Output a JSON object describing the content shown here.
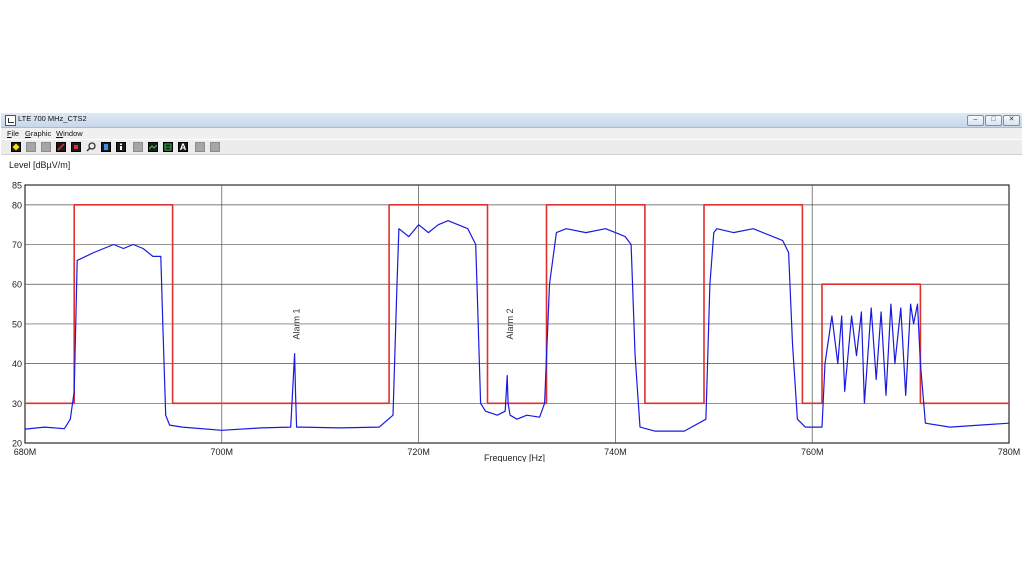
{
  "window": {
    "title": "LTE 700 MHz_CTS2",
    "menu": [
      {
        "label": "File",
        "accel": "F",
        "rest": "ile"
      },
      {
        "label": "Graphic",
        "accel": "G",
        "rest": "raphic"
      },
      {
        "label": "Window",
        "accel": "W",
        "rest": "indow"
      }
    ],
    "controls": {
      "minimize": "–",
      "maximize": "□",
      "close": "✕"
    },
    "toolbar_icons": [
      "diamond-icon",
      "grey-icon",
      "grey-icon",
      "marker-icon",
      "marker-icon",
      "magnifier-icon",
      "trace-icon",
      "info-icon",
      "grey-icon",
      "dark-icon",
      "dark-icon",
      "text-icon",
      "grey-icon",
      "grey-icon"
    ],
    "toolbar_text_icon_label": "A"
  },
  "colors": {
    "trace": "#1a1adf",
    "limit": "#e03030",
    "grid": "#505050",
    "diamond": "#f5e400"
  },
  "chart_data": {
    "type": "line",
    "xlabel": "Frequency [Hz]",
    "ylabel": "Level [dBµV/m]",
    "xlim": [
      680,
      780
    ],
    "ylim": [
      20,
      85
    ],
    "x_ticks": [
      680,
      700,
      720,
      740,
      760,
      780
    ],
    "x_tick_labels": [
      "680M",
      "700M",
      "720M",
      "740M",
      "760M",
      "780M"
    ],
    "y_ticks": [
      20,
      30,
      40,
      50,
      60,
      70,
      80,
      85
    ],
    "y_tick_labels": [
      "20",
      "30",
      "40",
      "50",
      "60",
      "70",
      "80",
      "85"
    ],
    "grid": true,
    "series": [
      {
        "role": "limit",
        "x": [
          680,
          685,
          685,
          695,
          695,
          717,
          717,
          727,
          727,
          733,
          733,
          743,
          743,
          749,
          749,
          759,
          759,
          761,
          761,
          771,
          771,
          780
        ],
        "y": [
          30,
          30,
          80,
          80,
          30,
          30,
          80,
          80,
          30,
          30,
          80,
          80,
          30,
          30,
          80,
          80,
          30,
          30,
          60,
          60,
          30,
          30
        ]
      },
      {
        "role": "measurement",
        "x": [
          680,
          682,
          684,
          684.6,
          685,
          685.3,
          687,
          689,
          690,
          691,
          692,
          693,
          693.8,
          694,
          694.3,
          694.7,
          696,
          700,
          704,
          707,
          707.4,
          707.5,
          707.6,
          708,
          712,
          716,
          717.4,
          717.8,
          718,
          719,
          720,
          721,
          722,
          723,
          724,
          725,
          725.8,
          726,
          726.3,
          726.8,
          728,
          728.8,
          729,
          729.1,
          729.3,
          730,
          731,
          732.3,
          732.8,
          733.3,
          734,
          735,
          737,
          739,
          740,
          741,
          741.6,
          742,
          742.5,
          744,
          747,
          749.2,
          749.6,
          750,
          750.3,
          752,
          754,
          756,
          757,
          757.6,
          758,
          758.5,
          759.3,
          760.5,
          761,
          761.3,
          762,
          762.6,
          763,
          763.3,
          764,
          764.5,
          765,
          765.3,
          766,
          766.5,
          767,
          767.5,
          768,
          768.4,
          769,
          769.5,
          770,
          770.3,
          770.7,
          771,
          771.5,
          774,
          777,
          780
        ],
        "y": [
          23.5,
          24,
          23.6,
          26,
          33,
          66,
          68,
          70,
          69,
          70,
          69,
          67,
          67,
          50,
          27,
          24.5,
          24,
          23.2,
          23.8,
          24,
          42.5,
          32,
          24,
          24,
          23.8,
          24,
          27,
          60,
          74,
          72,
          75,
          73,
          75,
          76,
          75,
          74,
          70,
          55,
          30,
          28,
          27,
          28,
          37,
          30,
          27,
          26,
          27,
          26.5,
          30,
          60,
          73,
          74,
          73,
          74,
          73,
          72,
          70,
          42,
          24,
          23,
          23,
          26,
          60,
          73,
          74,
          73,
          74,
          72,
          71,
          68,
          45,
          26,
          24,
          24,
          24,
          40,
          52,
          40,
          52,
          33,
          52,
          42,
          53,
          30,
          54,
          36,
          53,
          32,
          55,
          40,
          54,
          32,
          55,
          50,
          55,
          40,
          25,
          24,
          24.5,
          25
        ]
      }
    ],
    "annotations": [
      {
        "text": "Alarm 1",
        "x": 707.5,
        "y": 50
      },
      {
        "text": "Alarm 2",
        "x": 729.2,
        "y": 50
      }
    ]
  }
}
